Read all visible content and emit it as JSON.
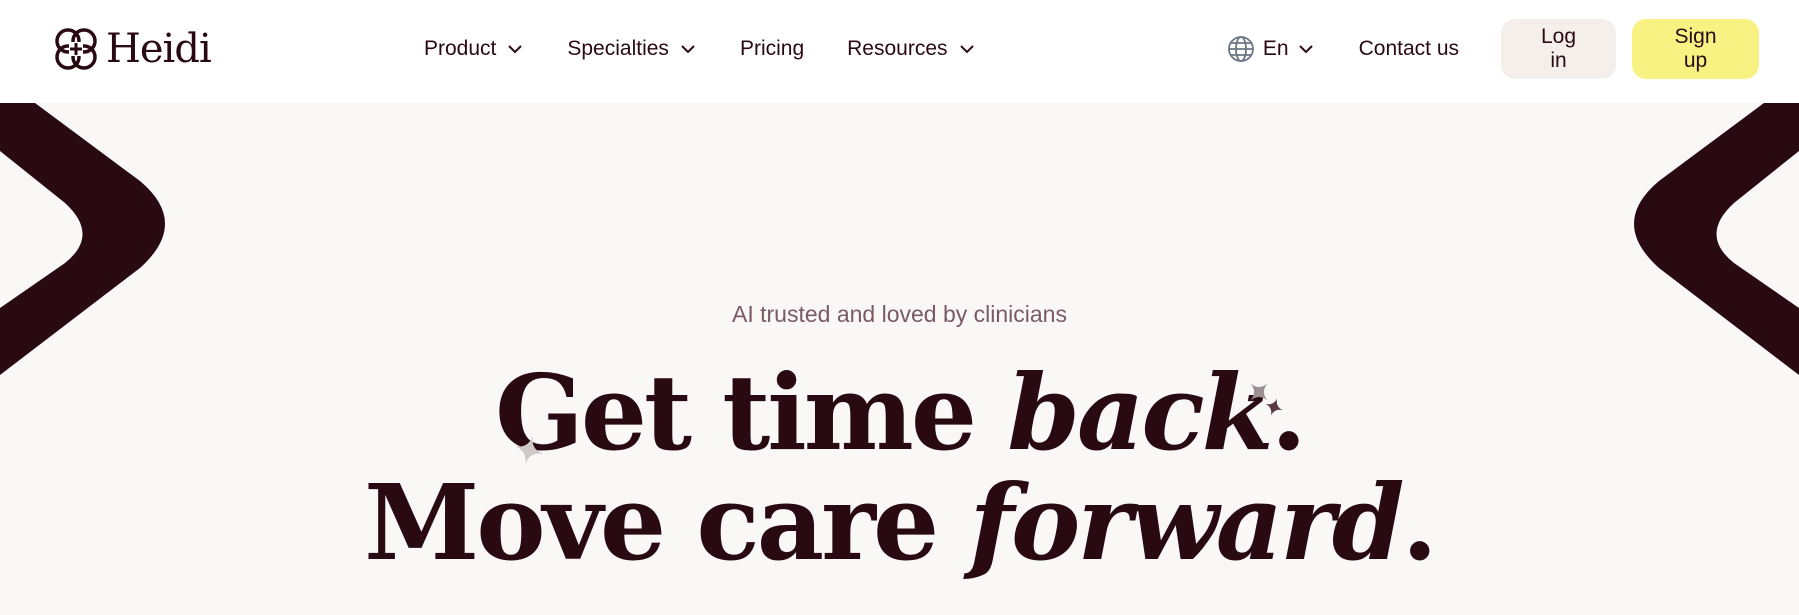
{
  "brand": {
    "name": "Heidi"
  },
  "nav": {
    "items": [
      {
        "label": "Product",
        "has_dropdown": true
      },
      {
        "label": "Specialties",
        "has_dropdown": true
      },
      {
        "label": "Pricing",
        "has_dropdown": false
      },
      {
        "label": "Resources",
        "has_dropdown": true
      }
    ]
  },
  "header_right": {
    "language": "En",
    "contact": "Contact us",
    "login": "Log in",
    "signup": "Sign up"
  },
  "hero": {
    "eyebrow": "AI trusted and loved by clinicians",
    "line1_plain": "Get time ",
    "line1_em": "back",
    "line1_end": ".",
    "line2_plain": "Move care ",
    "line2_em": "forward",
    "line2_end": "."
  },
  "colors": {
    "brand_dark": "#2a0a12",
    "signup_bg": "#f8f283",
    "login_bg": "#f5efec",
    "hero_bg": "#faf8f6"
  },
  "icons": [
    "logo-icon",
    "chevron-down-icon",
    "globe-icon",
    "sparkle-icon"
  ]
}
